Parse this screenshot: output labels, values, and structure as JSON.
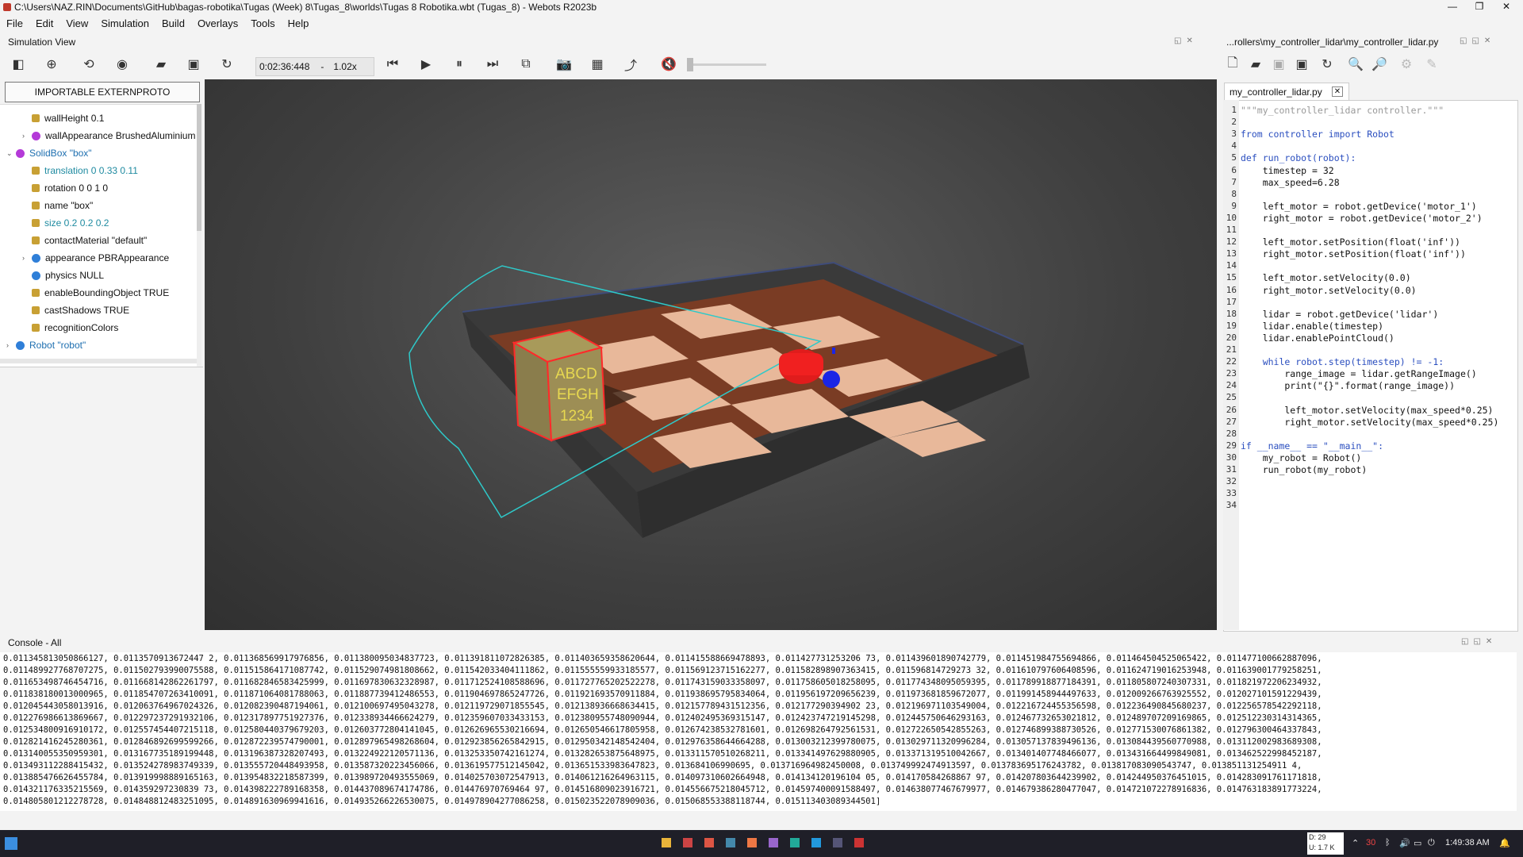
{
  "window": {
    "title": "C:\\Users\\NAZ.RIN\\Documents\\GitHub\\bagas-robotika\\Tugas (Week) 8\\Tugas_8\\worlds\\Tugas 8 Robotika.wbt (Tugas_8) - Webots R2023b",
    "minimize": "—",
    "maximize": "❐",
    "close": "✕"
  },
  "menu": [
    "File",
    "Edit",
    "View",
    "Simulation",
    "Build",
    "Overlays",
    "Tools",
    "Help"
  ],
  "simulation_view": {
    "title": "Simulation View",
    "time": "0:02:36:448",
    "dash": "-",
    "speed": "1.02x"
  },
  "editor": {
    "path_title": "...rollers\\my_controller_lidar\\my_controller_lidar.py",
    "tab_label": "my_controller_lidar.py",
    "tab_close": "✕",
    "line_numbers": [
      "1",
      "2",
      "3",
      "4",
      "5",
      "6",
      "7",
      "8",
      "9",
      "10",
      "11",
      "12",
      "13",
      "14",
      "15",
      "16",
      "17",
      "18",
      "19",
      "20",
      "21",
      "22",
      "23",
      "24",
      "25",
      "26",
      "27",
      "28",
      "29",
      "30",
      "31",
      "32",
      "33",
      "34"
    ],
    "lines": [
      "\"\"\"my_controller_lidar controller.\"\"\"",
      "",
      "from controller import Robot",
      "",
      "def run_robot(robot):",
      "    timestep = 32",
      "    max_speed=6.28",
      "",
      "    left_motor = robot.getDevice('motor_1')",
      "    right_motor = robot.getDevice('motor_2')",
      "",
      "    left_motor.setPosition(float('inf'))",
      "    right_motor.setPosition(float('inf'))",
      "",
      "    left_motor.setVelocity(0.0)",
      "    right_motor.setVelocity(0.0)",
      "",
      "    lidar = robot.getDevice('lidar')",
      "    lidar.enable(timestep)",
      "    lidar.enablePointCloud()",
      "",
      "    while robot.step(timestep) != -1:",
      "        range_image = lidar.getRangeImage()",
      "        print(\"{}\".format(range_image))",
      "",
      "        left_motor.setVelocity(max_speed*0.25)",
      "        right_motor.setVelocity(max_speed*0.25)",
      "",
      "if __name__ == \"__main__\":",
      "    my_robot = Robot()",
      "    run_robot(my_robot)",
      "",
      "",
      ""
    ]
  },
  "scene_tree": {
    "proto_button": "IMPORTABLE EXTERNPROTO",
    "rows": [
      {
        "label": "wallHeight 0.1",
        "kind": "field",
        "indent": 2,
        "arrow": "",
        "color": "#111"
      },
      {
        "label": "wallAppearance BrushedAluminium",
        "kind": "node",
        "indent": 2,
        "arrow": "›",
        "color": "#111",
        "icon": "#b43ad8"
      },
      {
        "label": "SolidBox \"box\"",
        "kind": "node",
        "indent": 0,
        "arrow": "⌄",
        "color": "#1e6fb0",
        "icon": "#b43ad8"
      },
      {
        "label": "translation 0 0.33 0.11",
        "kind": "field",
        "indent": 2,
        "arrow": "",
        "color": "#1e8aa0"
      },
      {
        "label": "rotation 0 0 1 0",
        "kind": "field",
        "indent": 2,
        "arrow": "",
        "color": "#111"
      },
      {
        "label": "name \"box\"",
        "kind": "field",
        "indent": 2,
        "arrow": "",
        "color": "#111"
      },
      {
        "label": "size 0.2 0.2 0.2",
        "kind": "field",
        "indent": 2,
        "arrow": "",
        "color": "#1e8aa0"
      },
      {
        "label": "contactMaterial \"default\"",
        "kind": "field",
        "indent": 2,
        "arrow": "",
        "color": "#111"
      },
      {
        "label": "appearance PBRAppearance",
        "kind": "node",
        "indent": 2,
        "arrow": "›",
        "color": "#111",
        "icon": "#2f7fd8"
      },
      {
        "label": "physics NULL",
        "kind": "node",
        "indent": 2,
        "arrow": "",
        "color": "#111",
        "icon": "#2f7fd8"
      },
      {
        "label": "enableBoundingObject TRUE",
        "kind": "field",
        "indent": 2,
        "arrow": "",
        "color": "#111"
      },
      {
        "label": "castShadows TRUE",
        "kind": "field",
        "indent": 2,
        "arrow": "",
        "color": "#111"
      },
      {
        "label": "recognitionColors",
        "kind": "field",
        "indent": 2,
        "arrow": "",
        "color": "#111"
      },
      {
        "label": "Robot \"robot\"",
        "kind": "node",
        "indent": 0,
        "arrow": "›",
        "color": "#1e6fb0",
        "icon": "#2f7fd8"
      }
    ]
  },
  "viewport": {
    "box_text": [
      "ABCD",
      "EFGH",
      "1234"
    ],
    "colors": {
      "robot": "#e01c1c",
      "wheel": "#1a25e6",
      "lidar_ray": "#2ec9c9",
      "box_outline": "#ff2a2a"
    }
  },
  "console": {
    "title": "Console - All",
    "lines": [
      "0.011345813050866127, 0.0113570913672447 2, 0.011368569917976856, 0.011380095034837723, 0.011391811072826385, 0.011403659358620644, 0.011415588669478893, 0.011427731253206 73, 0.011439601890742779, 0.011451984755694866, 0.011464504525065422, 0.011477100662887096,",
      "0.011489927768707275, 0.011502793990075588, 0.011515864171087742, 0.011529074981808662, 0.011542033404111862, 0.011555559933185577, 0.011569123715162277, 0.011582898907363415, 0.011596814729273 32, 0.011610797606408596, 0.011624719016253948, 0.011639001779258251,",
      "0.011653498746454716, 0.011668142862261797, 0.011682846583425999, 0.011697830632328987, 0.011712524108588696, 0.011727765202522278, 0.011743159033358097, 0.011758605018258095, 0.011774348095059395, 0.011789918877184391, 0.011805807240307331, 0.011821972206234932,",
      "0.011838180013000965, 0.011854707263410091, 0.011871064081788063, 0.011887739412486553, 0.011904697865247726, 0.011921693570911884, 0.011938695795834064, 0.011956197209656239, 0.011973681859672077, 0.011991458944497633, 0.012009266763925552, 0.012027101591229439,",
      "0.012045443058013916, 0.012063764967024326, 0.012082390487194061, 0.012100697495043278, 0.012119729071855545, 0.012138936668634415, 0.012157789431512356, 0.012177290394902 23, 0.012196971103549004, 0.012216724455356598, 0.012236490845680237, 0.012256578542292118,",
      "0.012276986613869667, 0.012297237291932106, 0.012317897751927376, 0.012338934466624279, 0.012359607033433153, 0.012380955748090944, 0.012402495369315147, 0.012423747219145298, 0.012445750646293163, 0.012467732653021812, 0.012489707209169865, 0.012512230314314365,",
      "0.012534800916910172, 0.012557454407215118, 0.012580440379679203, 0.012603772804141045, 0.012626965530216694, 0.012650546617805958, 0.012674238532781601, 0.012698264792561531, 0.012722650542855263, 0.012746899388730526, 0.012771530076861382, 0.012796300464337843,",
      "0.012821416245280361, 0.012846892699599266, 0.012872239574790001, 0.012897965498268604, 0.012923856265842915, 0.012950342148542404, 0.012976358644664288, 0.013003212399780075, 0.013029711320996284, 0.013057137839496136, 0.013084439560770988, 0.013112002983689308,",
      "0.013140055350959301, 0.013167735189199448, 0.013196387328207493, 0.013224922120571136, 0.013253350742161274, 0.013282653875648975, 0.013311570510268211, 0.013341497629880905, 0.013371319510042667, 0.013401407748466077, 0.013431664499849081, 0.013462522998452187,",
      "0.013493112288415432, 0.013524278983749339, 0.013555720448493958, 0.013587320223456066, 0.013619577512145042, 0.013651533983647823, 0.013684106990695, 0.013716964982450008, 0.013749992474913597, 0.013783695176243782, 0.013817083090543747, 0.013851131254911 4,",
      "0.013885476626455784, 0.013919998889165163, 0.013954832218587399, 0.013989720493555069, 0.014025703072547913, 0.014061216264963115, 0.014097310602664948, 0.014134120196104 05, 0.014170584268867 97, 0.014207803644239902, 0.014244950376451015, 0.014283091761171818,",
      "0.014321176335215569, 0.014359297230839 73, 0.014398222789168358, 0.014437089674174786, 0.014476970769464 97, 0.014516809023916721, 0.014556675218045712, 0.014597400091588497, 0.014638077467679977, 0.014679386280477047, 0.014721072278916836, 0.014763183891773224,",
      "0.014805801212278728, 0.014848812483251095, 0.014891630969941616, 0.014935266226530075, 0.014978904277086258, 0.015023522078909036, 0.015068553388118744, 0.015113403089344501]"
    ]
  },
  "taskbar": {
    "net_down": "D: 29",
    "net_up": "U: 1.7 K",
    "time": "1:49:38 AM",
    "temp": "30"
  }
}
